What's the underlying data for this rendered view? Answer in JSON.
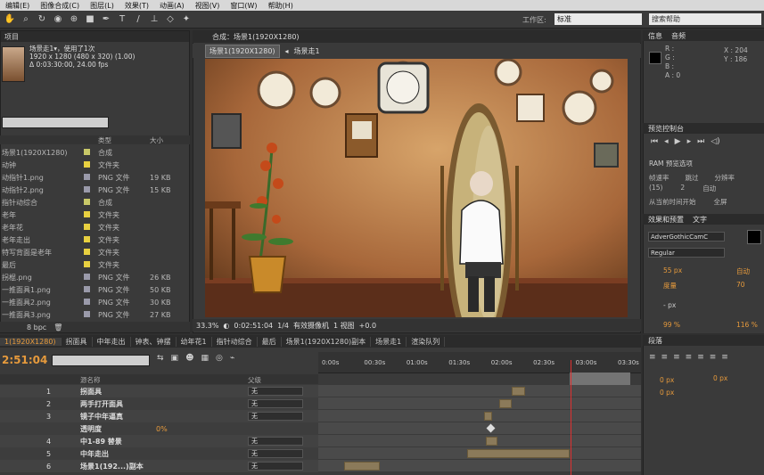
{
  "menubar": [
    "编辑(E)",
    "图像合成(C)",
    "图层(L)",
    "效果(T)",
    "动画(A)",
    "视图(V)",
    "窗口(W)",
    "帮助(H)"
  ],
  "workspace": {
    "label": "工作区:",
    "value": "标准",
    "search_placeholder": "搜索帮助"
  },
  "project": {
    "tab": "项目",
    "item_name": "场景走1▾",
    "item_usage": "，使用了1次",
    "item_size": "1920 x 1280  (480 x 320) (1.00)",
    "item_duration": "Δ 0:03:30:00, 24.00 fps",
    "columns": {
      "type": "类型",
      "size": "大小"
    },
    "rows": [
      {
        "name": "场景1(1920X1280)",
        "type": "合成",
        "size": "",
        "color": "#c8c868"
      },
      {
        "name": "动钟",
        "type": "文件夹",
        "size": "",
        "color": "#e8d040"
      },
      {
        "name": "动指针1.png",
        "type": "PNG 文件",
        "size": "19 KB",
        "color": "#9a9aaa"
      },
      {
        "name": "动指针2.png",
        "type": "PNG 文件",
        "size": "15 KB",
        "color": "#9a9aaa"
      },
      {
        "name": "指针动综合",
        "type": "合成",
        "size": "",
        "color": "#c8c868"
      },
      {
        "name": "老年",
        "type": "文件夹",
        "size": "",
        "color": "#e8d040"
      },
      {
        "name": "老年花",
        "type": "文件夹",
        "size": "",
        "color": "#e8d040"
      },
      {
        "name": "老年走出",
        "type": "文件夹",
        "size": "",
        "color": "#e8d040"
      },
      {
        "name": "特写背面是老年",
        "type": "文件夹",
        "size": "",
        "color": "#e8d040"
      },
      {
        "name": "最后",
        "type": "文件夹",
        "size": "",
        "color": "#e8d040"
      },
      {
        "name": "拐棍.png",
        "type": "PNG 文件",
        "size": "26 KB",
        "color": "#9a9aaa"
      },
      {
        "name": "一推面具1.png",
        "type": "PNG 文件",
        "size": "50 KB",
        "color": "#9a9aaa"
      },
      {
        "name": "一推面具2.png",
        "type": "PNG 文件",
        "size": "30 KB",
        "color": "#9a9aaa"
      },
      {
        "name": "一推面具3.png",
        "type": "PNG 文件",
        "size": "27 KB",
        "color": "#9a9aaa"
      }
    ],
    "footer": "8 bpc"
  },
  "composition": {
    "tab": "合成：场景1(1920X1280)",
    "flow": [
      "场景1(1920X1280)",
      "场景走1"
    ],
    "bottom": {
      "zoom": "33.3%",
      "time": "0:02:51:04",
      "res": "1/4",
      "camera": "有效摄像机",
      "views": "1 视图",
      "val": "+0.0"
    }
  },
  "right": {
    "info_tab": "信息",
    "audio_tab": "音频",
    "info": {
      "r": "R :",
      "g": "G :",
      "b": "B :",
      "a": "A : 0",
      "x": "X : 204",
      "y": "Y : 186"
    },
    "preview_tab": "预览控制台",
    "preview": {
      "ram": "RAM 预览选项",
      "fps_label": "帧速率",
      "skip_label": "跳过",
      "res_label": "分辨率",
      "fps": "(15)",
      "skip": "2",
      "res": "自动",
      "from_current": "从当前时间开始",
      "full": "全屏"
    },
    "effects_tab": "效果和预置",
    "char_tab": "文字",
    "char": {
      "font": "AdverGothicCamC",
      "style": "Regular",
      "size": "55 px",
      "leading": "自动",
      "kern": "度量",
      "track": "70",
      "stroke": "- px",
      "vscale": "99 %",
      "hscale": "116 %"
    },
    "para_tab": "段落",
    "para": {
      "v1": "0 px",
      "v2": "0 px",
      "v3": "0 px"
    }
  },
  "timeline": {
    "tabs": [
      "1(1920X1280)",
      "拐面具",
      "中年走出",
      "钟表、钟摆",
      "幼年花1",
      "指针动综合",
      "最后",
      "场景1(1920X1280)副本",
      "场景走1",
      "渲染队列"
    ],
    "active_tab": 0,
    "timecode": "2:51:04",
    "ruler": [
      "0:00s",
      "00:30s",
      "01:00s",
      "01:30s",
      "02:00s",
      "02:30s",
      "03:00s",
      "03:30s"
    ],
    "header": {
      "name": "源名称",
      "parent": "父级"
    },
    "layers": [
      {
        "num": "1",
        "name": "拐面具",
        "mode": "无",
        "bar": [
          0.6,
          0.64
        ]
      },
      {
        "num": "2",
        "name": "两手打开面具",
        "mode": "无",
        "bar": [
          0.56,
          0.6
        ]
      },
      {
        "num": "3",
        "name": "镜子中年逼真",
        "mode": "无",
        "bar": [
          0.515,
          0.54
        ]
      },
      {
        "num": "",
        "name": "透明度",
        "mode": "",
        "value": "0%",
        "bar": null
      },
      {
        "num": "4",
        "name": "中1-89 替景",
        "mode": "无",
        "bar": [
          0.52,
          0.555
        ]
      },
      {
        "num": "5",
        "name": "中年走出",
        "mode": "无",
        "bar": [
          0.46,
          0.78
        ]
      },
      {
        "num": "6",
        "name": "场景1(192...)副本",
        "mode": "无",
        "bar": [
          0.08,
          0.19
        ]
      }
    ]
  }
}
